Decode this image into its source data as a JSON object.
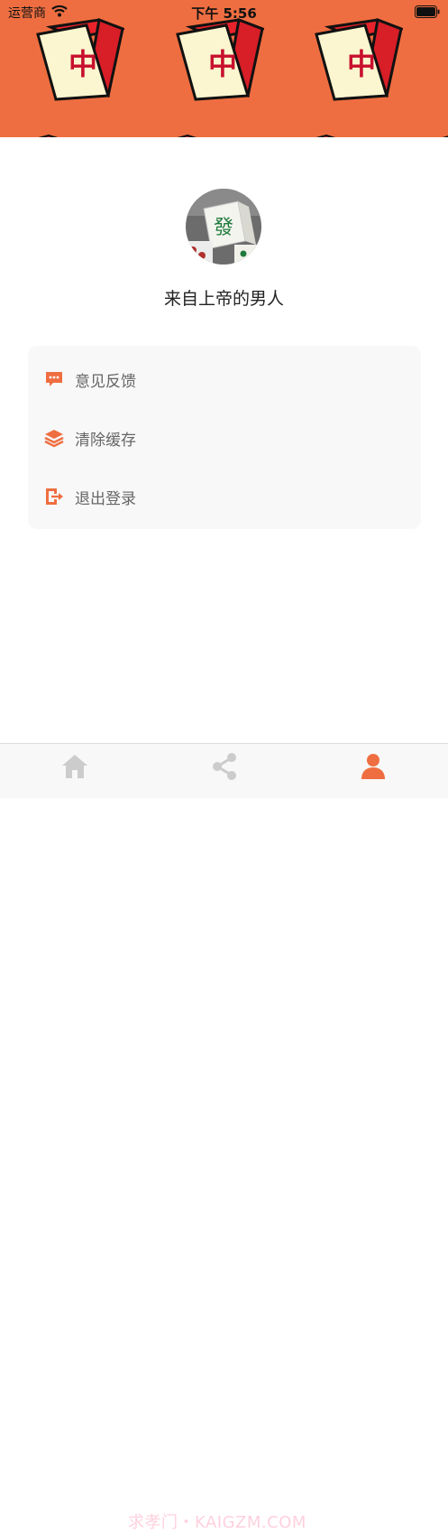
{
  "status_bar": {
    "carrier": "运营商",
    "time": "下午 5:56"
  },
  "banner": {
    "background_color": "#ef6e41",
    "tile_glyph": "中"
  },
  "profile": {
    "username": "来自上帝的男人",
    "avatar_glyph": "發"
  },
  "menu": {
    "items": [
      {
        "label": "意见反馈",
        "icon": "chat-bubble-icon"
      },
      {
        "label": "清除缓存",
        "icon": "layers-icon"
      },
      {
        "label": "退出登录",
        "icon": "logout-icon"
      }
    ]
  },
  "tabbar": {
    "tabs": [
      {
        "name": "home",
        "icon": "home-icon",
        "active": false
      },
      {
        "name": "share",
        "icon": "share-icon",
        "active": false
      },
      {
        "name": "profile",
        "icon": "person-icon",
        "active": true
      }
    ],
    "active_color": "#ef6e41",
    "inactive_color": "#cccccc",
    "watermark": "求孝门・KAIGZM.COM"
  }
}
